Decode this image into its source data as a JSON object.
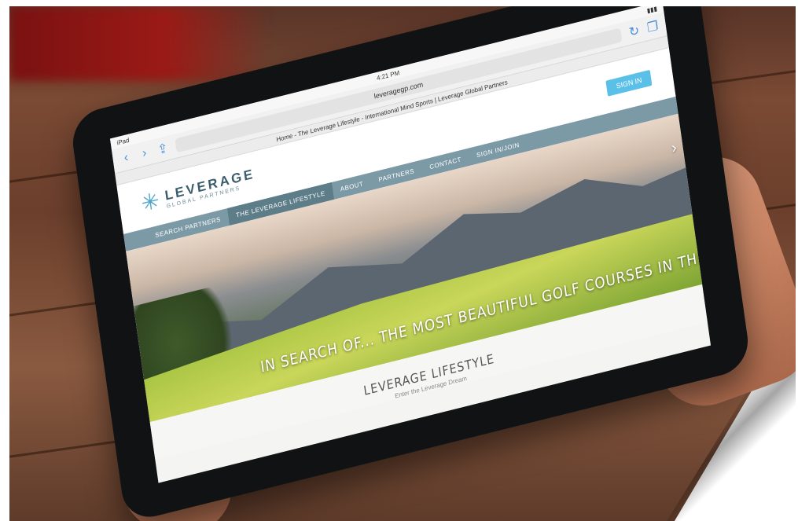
{
  "browser": {
    "time": "4:21 PM",
    "url": "leveragegp.com",
    "page_title": "Home - The Leverage Lifestyle - International Mind Sports | Leverage Global Partners"
  },
  "site": {
    "logo_name": "LEVERAGE",
    "logo_sub": "GLOBAL PARTNERS",
    "signin_label": "SIGN IN",
    "nav": [
      {
        "label": "SEARCH PARTNERS",
        "active": false
      },
      {
        "label": "THE LEVERAGE LIFESTYLE",
        "active": true
      },
      {
        "label": "ABOUT",
        "active": false
      },
      {
        "label": "PARTNERS",
        "active": false
      },
      {
        "label": "CONTACT",
        "active": false
      },
      {
        "label": "SIGN IN/JOIN",
        "active": false
      }
    ]
  },
  "hero": {
    "headline": "IN SEARCH OF... THE MOST BEAUTIFUL GOLF COURSES IN THE US"
  },
  "section": {
    "title": "LEVERAGE LIFESTYLE",
    "subtitle": "Enter the Leverage Dream"
  },
  "icons": {
    "back": "chevron-left-icon",
    "forward": "chevron-right-icon",
    "share": "share-icon",
    "reload": "reload-icon",
    "tabs": "tabs-icon",
    "logo": "star-logo-icon"
  }
}
